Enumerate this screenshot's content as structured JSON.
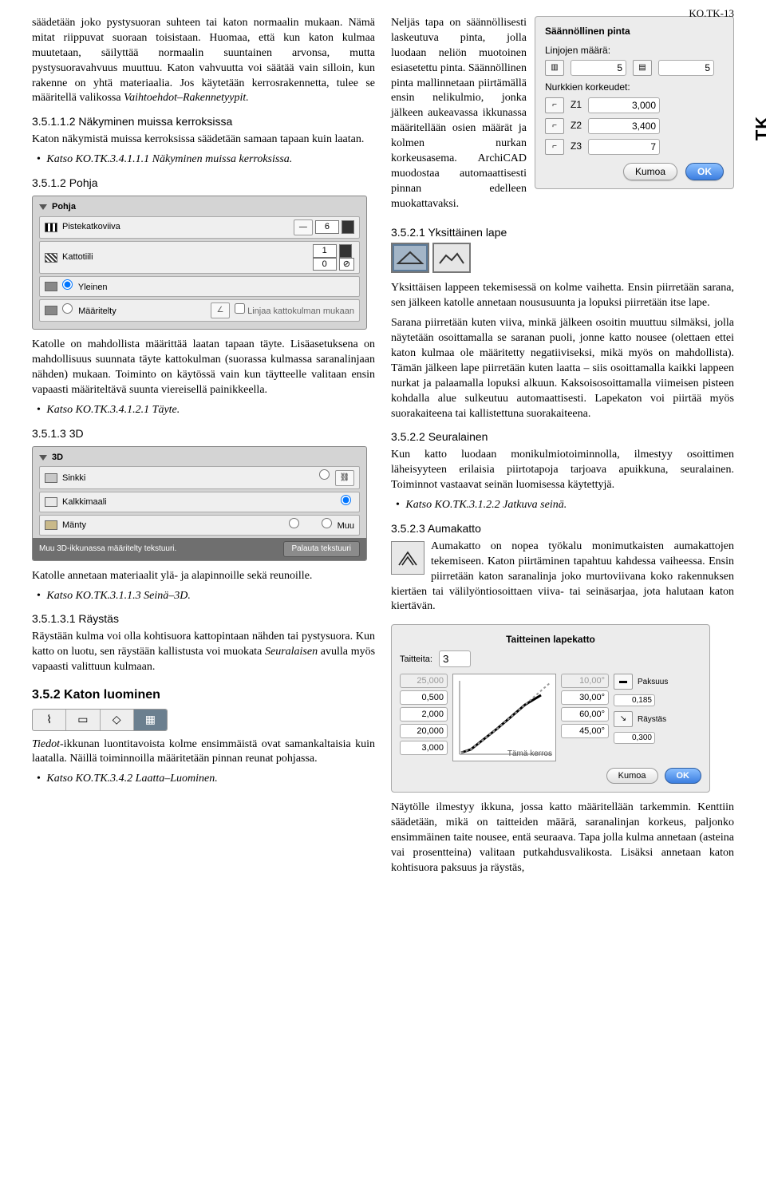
{
  "header_code": "KO.TK-13",
  "side_tab": "TK",
  "p1": "säädetään joko pystysuoran suhteen tai katon normaalin mukaan. Nämä mitat riippuvat suoraan toisistaan. Huomaa, että kun katon kulmaa muutetaan, säilyttää normaalin suuntainen arvonsa, mutta pystysuoravahvuus muuttuu. Katon vahvuutta voi säätää vain silloin, kun rakenne on yhtä materiaalia. Jos käytetään kerrosrakennetta, tulee se määritellä valikossa",
  "p1_italic": "Vaihtoehdot–Rakennetyypit.",
  "h_3_5_1_1_2": "3.5.1.1.2 Näkyminen muissa kerroksissa",
  "p2": "Katon näkymistä muissa kerroksissa säädetään samaan tapaan kuin laatan.",
  "b1": "Katso KO.TK.3.4.1.1.1 Näkyminen muissa kerroksissa.",
  "h_3_5_1_2": "3.5.1.2 Pohja",
  "pohja": {
    "title": "Pohja",
    "r1_label": "Pistekatkoviiva",
    "r1_val": "6",
    "r2_label": "Kattotiili",
    "r2_v1": "1",
    "r2_v2": "0",
    "r3_opt1": "Yleinen",
    "r3_opt2": "Määritelty",
    "r3_chk": "Linjaa kattokulman mukaan"
  },
  "p3": "Katolle on mahdollista määrittää laatan tapaan täyte. Lisäasetuksena on mahdollisuus suunnata täyte kattokulman (suorassa kulmassa saranalinjaan nähden) mukaan. Toiminto on käytössä vain kun täytteelle valitaan ensin vapaasti määriteltävä suunta viereisellä painikkeella.",
  "b2": "Katso KO.TK.3.4.1.2.1 Täyte.",
  "h_3_5_1_3": "3.5.1.3 3D",
  "d3": {
    "title": "3D",
    "m1": "Sinkki",
    "m2": "Kalkkimaali",
    "m3": "Mänty",
    "muu": "Muu",
    "foot_l": "Muu 3D-ikkunassa määritelty tekstuuri.",
    "foot_r": "Palauta tekstuuri"
  },
  "p4": "Katolle annetaan materiaalit ylä- ja alapinnoille sekä reunoille.",
  "b3": "Katso KO.TK.3.1.1.3 Seinä–3D.",
  "h_raystas": "3.5.1.3.1 Räystäs",
  "p5a": "Räystään kulma voi olla kohtisuora kattopintaan nähden tai pystysuora. Kun katto on luotu, sen räystään kallistusta voi muokata",
  "p5b": "Seuralaisen",
  "p5c": "avulla myös vapaasti valittuun kulmaan.",
  "h_3_5_2": "3.5.2 Katon luominen",
  "p6a": "Tiedot",
  "p6b": "-ikkunan luontitavoista kolme ensimmäistä ovat samankaltaisia kuin laatalla. Näillä toiminnoilla määritetään pinnan reunat pohjassa.",
  "b4": "Katso KO.TK.3.4.2 Laatta–Luominen.",
  "saann": {
    "title": "Säännöllinen pinta",
    "lbl_lin": "Linjojen määrä:",
    "lin_a": "5",
    "lin_b": "5",
    "lbl_nur": "Nurkkien korkeudet:",
    "z1": "Z1",
    "z1v": "3,000",
    "z2": "Z2",
    "z2v": "3,400",
    "z3": "Z3",
    "z3v": "7",
    "cancel": "Kumoa",
    "ok": "OK"
  },
  "p7": "Neljäs tapa on säännöllisesti laskeutuva pinta, jolla luodaan neliön muotoinen esiasetettu pinta. Säännöllinen pinta mallinnetaan piirtämällä ensin nelikulmio, jonka jälkeen aukeavassa ikkunassa määritellään osien määrät ja kolmen nurkan korkeusasema. ArchiCAD muodostaa automaattisesti pinnan edelleen muokattavaksi.",
  "h_3_5_2_1": "3.5.2.1 Yksittäinen lape",
  "p8": "Yksittäisen lappeen tekemisessä on kolme vaihetta. Ensin piirretään sarana, sen jälkeen katolle annetaan noususuunta ja lopuksi piirretään itse lape.",
  "p9": "Sarana piirretään kuten viiva, minkä jälkeen osoitin muuttuu silmäksi, jolla näytetään osoittamalla se saranan puoli, jonne katto nousee (olettaen ettei katon kulmaa ole määritetty negatiiviseksi, mikä myös on mahdollista). Tämän jälkeen lape piirretään kuten laatta – siis osoittamalla kaikki lappeen nurkat ja palaamalla lopuksi alkuun. Kaksoisosoittamalla viimeisen pisteen kohdalla alue sulkeutuu automaattisesti. Lapekaton voi piirtää myös suorakaiteena tai kallistettuna suorakaiteena.",
  "h_3_5_2_2": "3.5.2.2 Seuralainen",
  "p10": "Kun katto luodaan monikulmiotoiminnolla, ilmestyy osoittimen läheisyyteen erilaisia piirtotapoja tarjoava apuikkuna, seuralainen. Toiminnot vastaavat seinän luomisessa käytettyjä.",
  "b5": "Katso KO.TK.3.1.2.2 Jatkuva seinä.",
  "h_3_5_2_3": "3.5.2.3 Aumakatto",
  "p11": "Aumakatto on nopea työkalu monimutkaisten aumakattojen tekemiseen. Katon piirtäminen tapahtuu kahdessa vaiheessa. Ensin piirretään katon saranalinja joko murtoviivana koko rakennuksen kiertäen tai välilyöntiosoittaen viiva- tai seinäsarjaa, jota halutaan katon kiertävän.",
  "tlk": {
    "title": "Taitteinen lapekatto",
    "lbl_t": "Taitteita:",
    "t_val": "3",
    "colA": [
      "25,000",
      "0,500",
      "2,000",
      "20,000",
      "3,000"
    ],
    "colA_dim0": true,
    "mid": "Tämä kerros",
    "colB": [
      "10,00°",
      "30,00°",
      "60,00°",
      "45,00°"
    ],
    "colB_dim0": true,
    "lbl_pak": "Paksuus",
    "pak_val": "0,185",
    "lbl_ray": "Räystäs",
    "ray_val": "0,300",
    "cancel": "Kumoa",
    "ok": "OK"
  },
  "p12": "Näytölle ilmestyy ikkuna, jossa katto määritellään tarkemmin. Kenttiin säädetään, mikä on taitteiden määrä, saranalinjan korkeus, paljonko ensimmäinen taite nousee, entä seuraava. Tapa jolla kulma annetaan (asteina vai prosentteina) valitaan putkahdusvalikosta. Lisäksi annetaan katon kohtisuora paksuus ja räystäs,"
}
